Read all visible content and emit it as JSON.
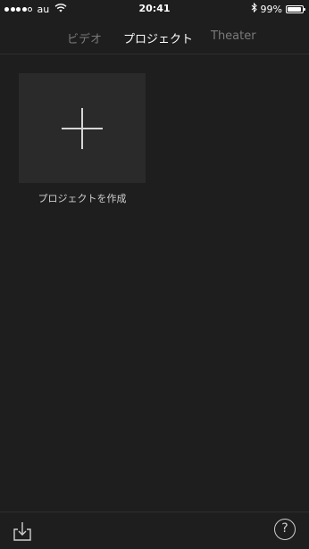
{
  "status_bar": {
    "carrier": "au",
    "time": "20:41",
    "battery_pct": "99%",
    "signal_bars": 4,
    "signal_total": 5
  },
  "tabs": [
    {
      "label": "ビデオ",
      "active": false
    },
    {
      "label": "プロジェクト",
      "active": true
    },
    {
      "label": "Theater",
      "active": false
    }
  ],
  "content": {
    "create_label": "プロジェクトを作成"
  },
  "toolbar": {
    "help_glyph": "?",
    "import_icon": "import-icon"
  }
}
